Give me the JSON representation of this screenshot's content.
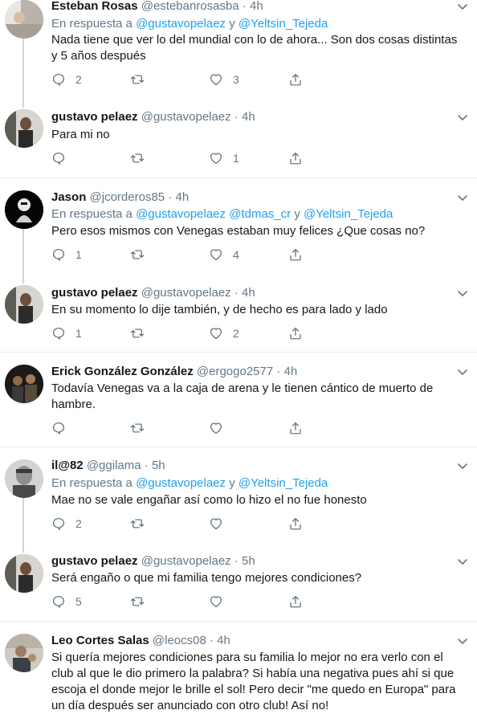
{
  "tweets": [
    {
      "name": "Esteban Rosas",
      "handle": "@estebanrosasba",
      "dot": "·",
      "time": "4h",
      "reply_prefix": "En respuesta a",
      "reply_mentions": [
        "@gustavopelaez",
        "@Yeltsin_Tejeda"
      ],
      "reply_joiner": "y",
      "text": "Nada tiene que ver lo del mundial con lo de ahora... Son dos cosas distintas y 5 años después",
      "replies": "2",
      "retweets": "",
      "likes": "3"
    },
    {
      "name": "gustavo pelaez",
      "handle": "@gustavopelaez",
      "dot": "·",
      "time": "4h",
      "text": "Para mi no",
      "replies": "",
      "retweets": "",
      "likes": "1"
    },
    {
      "name": "Jason",
      "handle": "@jcorderos85",
      "dot": "·",
      "time": "4h",
      "reply_prefix": "En respuesta a",
      "reply_mentions": [
        "@gustavopelaez",
        "@tdmas_cr",
        "@Yeltsin_Tejeda"
      ],
      "reply_joiner": "y",
      "text": "Pero esos mismos con Venegas estaban muy felices ¿Que cosas no?",
      "replies": "1",
      "retweets": "",
      "likes": "4"
    },
    {
      "name": "gustavo pelaez",
      "handle": "@gustavopelaez",
      "dot": "·",
      "time": "4h",
      "text": "En su momento lo dije también, y de hecho es para lado y lado",
      "replies": "1",
      "retweets": "",
      "likes": "2"
    },
    {
      "name": "Erick González González",
      "handle": "@ergogo2577",
      "dot": "·",
      "time": "4h",
      "text": "Todavía Venegas va a la caja de arena y le tienen cántico de muerto de hambre.",
      "replies": "",
      "retweets": "",
      "likes": ""
    },
    {
      "name": "il@82",
      "handle": "@ggilama",
      "dot": "·",
      "time": "5h",
      "reply_prefix": "En respuesta a",
      "reply_mentions": [
        "@gustavopelaez",
        "@Yeltsin_Tejeda"
      ],
      "reply_joiner": "y",
      "text": "Mae no se vale engañar así como lo hizo el no fue honesto",
      "replies": "2",
      "retweets": "",
      "likes": ""
    },
    {
      "name": "gustavo pelaez",
      "handle": "@gustavopelaez",
      "dot": "·",
      "time": "5h",
      "text": "Será engaño o que mi familia tengo mejores condiciones?",
      "replies": "5",
      "retweets": "",
      "likes": ""
    },
    {
      "name": "Leo Cortes Salas",
      "handle": "@leocs08",
      "dot": "·",
      "time": "4h",
      "text": "Si quería mejores condiciones para su familia lo mejor no era verlo con el club al que le dio primero la palabra? Si había una negativa pues ahí si que escoja el donde mejor le brille el sol! Pero decir \"me quedo en Europa\" para un día después ser anunciado con otro club! Así no!",
      "replies": "",
      "retweets": "",
      "likes": ""
    }
  ],
  "icons": {
    "reply": "reply-icon",
    "retweet": "retweet-icon",
    "like": "heart-icon",
    "share": "share-icon",
    "more": "chevron-down-icon"
  },
  "colors": {
    "mention": "#1da1f2",
    "secondary": "#657786",
    "text": "#14171a",
    "divider": "#e6ecf0",
    "thread": "#ccd6dd"
  }
}
